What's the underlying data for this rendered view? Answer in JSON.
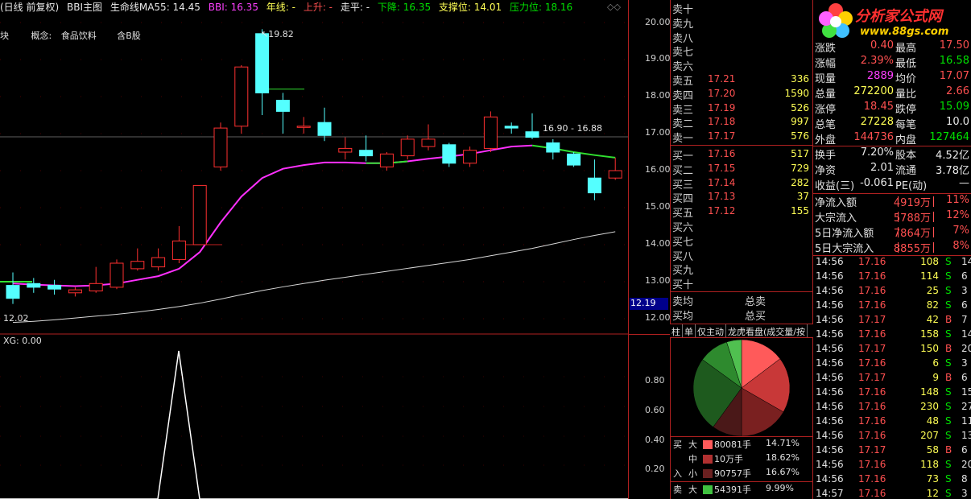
{
  "top_bar": {
    "mode": "(日线 前复权)",
    "indicator": "BBI主图",
    "lifeline": "生命线MA55: 14.45",
    "bbi": "BBI: 16.35",
    "yearline": "年线: -",
    "rise": "上升: -",
    "flat": "走平: -",
    "fall": "下降: 16.35",
    "support": "支撑位: 14.01",
    "pressure": "压力位: 18.16"
  },
  "concept_bar": {
    "prefix": "块",
    "concept_label": "概念:",
    "concept1": "食品饮料",
    "concept2": "含B股"
  },
  "chart_annotations": {
    "high_label": "19.82",
    "range_label": "16.90 - 16.88",
    "low_label": "12.02"
  },
  "price_axis": {
    "ticks": [
      "20.00",
      "19.00",
      "18.00",
      "17.00",
      "16.00",
      "15.00",
      "14.00",
      "13.00",
      "12.00"
    ],
    "current": "12.19",
    "sub_ticks": [
      "0.80",
      "0.60",
      "0.40",
      "0.20"
    ]
  },
  "sub_chart": {
    "label": "XG: 0.00"
  },
  "orderbook": {
    "sell": [
      {
        "label": "卖十",
        "price": "",
        "vol": ""
      },
      {
        "label": "卖九",
        "price": "",
        "vol": ""
      },
      {
        "label": "卖八",
        "price": "",
        "vol": ""
      },
      {
        "label": "卖七",
        "price": "",
        "vol": ""
      },
      {
        "label": "卖六",
        "price": "",
        "vol": ""
      },
      {
        "label": "卖五",
        "price": "17.21",
        "vol": "336"
      },
      {
        "label": "卖四",
        "price": "17.20",
        "vol": "1590"
      },
      {
        "label": "卖三",
        "price": "17.19",
        "vol": "526"
      },
      {
        "label": "卖二",
        "price": "17.18",
        "vol": "997"
      },
      {
        "label": "卖一",
        "price": "17.17",
        "vol": "576"
      }
    ],
    "buy": [
      {
        "label": "买一",
        "price": "17.16",
        "vol": "517"
      },
      {
        "label": "买二",
        "price": "17.15",
        "vol": "729"
      },
      {
        "label": "买三",
        "price": "17.14",
        "vol": "282"
      },
      {
        "label": "买四",
        "price": "17.13",
        "vol": "37"
      },
      {
        "label": "买五",
        "price": "17.12",
        "vol": "155"
      },
      {
        "label": "买六",
        "price": "",
        "vol": ""
      },
      {
        "label": "买七",
        "price": "",
        "vol": ""
      },
      {
        "label": "买八",
        "price": "",
        "vol": ""
      },
      {
        "label": "买九",
        "price": "",
        "vol": ""
      },
      {
        "label": "买十",
        "price": "",
        "vol": ""
      }
    ],
    "avg_sell": "卖均",
    "total_sell": "总卖",
    "avg_buy": "买均",
    "total_buy": "总买"
  },
  "tabs": [
    "柱",
    "单",
    "仅主动",
    "龙虎看盘(成交量/按"
  ],
  "flow": {
    "buy_label": "买",
    "in_label": "入",
    "sell_label": "卖",
    "rows": [
      {
        "size": "大",
        "amount": "80081手",
        "pct": "14.71%",
        "color": "#ff5a5a"
      },
      {
        "size": "中",
        "amount": "10万手",
        "pct": "18.62%",
        "color": "#b03030"
      },
      {
        "size": "小",
        "amount": "90757手",
        "pct": "16.67%",
        "color": "#6a2020"
      },
      {
        "size": "大",
        "amount": "54391手",
        "pct": "9.99%",
        "color": "#40c040"
      }
    ]
  },
  "pie_colors": [
    "#ff5a5a",
    "#c83838",
    "#7a2020",
    "#4a1818",
    "#1e5a1e",
    "#2e8a2e",
    "#50c050"
  ],
  "logo": {
    "title": "分析家公式网",
    "url": "www.88gs.com"
  },
  "quote": [
    {
      "k1": "涨跌",
      "v1": "0.40",
      "c1": "red",
      "k2": "最高",
      "v2": "17.50",
      "c2": "red"
    },
    {
      "k1": "涨幅",
      "v1": "2.39%",
      "c1": "red",
      "k2": "最低",
      "v2": "16.58",
      "c2": "green"
    },
    {
      "k1": "现量",
      "v1": "2889",
      "c1": "magenta",
      "k2": "均价",
      "v2": "17.07",
      "c2": "red"
    },
    {
      "k1": "总量",
      "v1": "272200",
      "c1": "yellow",
      "k2": "量比",
      "v2": "2.66",
      "c2": "red"
    },
    {
      "k1": "涨停",
      "v1": "18.45",
      "c1": "red",
      "k2": "跌停",
      "v2": "15.09",
      "c2": "green"
    },
    {
      "k1": "总笔",
      "v1": "27228",
      "c1": "yellow",
      "k2": "每笔",
      "v2": "10.0",
      "c2": "white"
    },
    {
      "k1": "外盘",
      "v1": "144736",
      "c1": "red",
      "k2": "内盘",
      "v2": "127464",
      "c2": "green"
    }
  ],
  "fundamentals": [
    {
      "k1": "换手",
      "v1": "7.20%",
      "k2": "股本",
      "v2": "4.52亿"
    },
    {
      "k1": "净资",
      "v1": "2.01",
      "k2": "流通",
      "v2": "3.78亿"
    },
    {
      "k1": "收益(三)",
      "v1": "-0.061",
      "k2": "PE(动)",
      "v2": "—"
    }
  ],
  "capital_flow": [
    {
      "k": "净流入额",
      "v": "4919万",
      "p": "11%"
    },
    {
      "k": "大宗流入",
      "v": "5788万",
      "p": "12%"
    },
    {
      "k": "5日净流入额",
      "v": "7864万",
      "p": "7%"
    },
    {
      "k": "5日大宗流入",
      "v": "8855万",
      "p": "8%"
    }
  ],
  "ticks": [
    {
      "t": "14:56",
      "p": "17.16",
      "v": "108",
      "d": "S",
      "n": "14"
    },
    {
      "t": "14:56",
      "p": "17.16",
      "v": "114",
      "d": "S",
      "n": "6"
    },
    {
      "t": "14:56",
      "p": "17.16",
      "v": "25",
      "d": "S",
      "n": "3"
    },
    {
      "t": "14:56",
      "p": "17.16",
      "v": "82",
      "d": "S",
      "n": "6"
    },
    {
      "t": "14:56",
      "p": "17.17",
      "v": "42",
      "d": "B",
      "n": "7"
    },
    {
      "t": "14:56",
      "p": "17.16",
      "v": "158",
      "d": "S",
      "n": "14"
    },
    {
      "t": "14:56",
      "p": "17.17",
      "v": "150",
      "d": "B",
      "n": "20"
    },
    {
      "t": "14:56",
      "p": "17.16",
      "v": "6",
      "d": "S",
      "n": "3"
    },
    {
      "t": "14:56",
      "p": "17.17",
      "v": "9",
      "d": "B",
      "n": "6"
    },
    {
      "t": "14:56",
      "p": "17.16",
      "v": "148",
      "d": "S",
      "n": "15"
    },
    {
      "t": "14:56",
      "p": "17.16",
      "v": "230",
      "d": "S",
      "n": "27"
    },
    {
      "t": "14:56",
      "p": "17.16",
      "v": "48",
      "d": "S",
      "n": "11"
    },
    {
      "t": "14:56",
      "p": "17.16",
      "v": "207",
      "d": "S",
      "n": "13"
    },
    {
      "t": "14:56",
      "p": "17.17",
      "v": "58",
      "d": "B",
      "n": "6"
    },
    {
      "t": "14:56",
      "p": "17.16",
      "v": "118",
      "d": "S",
      "n": "20"
    },
    {
      "t": "14:56",
      "p": "17.16",
      "v": "73",
      "d": "S",
      "n": "8"
    },
    {
      "t": "14:57",
      "p": "17.16",
      "v": "12",
      "d": "S",
      "n": "3"
    }
  ],
  "candles": [
    {
      "o": 12.9,
      "c": 12.55,
      "h": 13.25,
      "l": 12.4
    },
    {
      "o": 12.95,
      "c": 12.85,
      "h": 13.1,
      "l": 12.7
    },
    {
      "o": 12.9,
      "c": 12.8,
      "h": 13.05,
      "l": 12.65
    },
    {
      "o": 12.7,
      "c": 12.78,
      "h": 12.85,
      "l": 12.6
    },
    {
      "o": 12.75,
      "c": 12.95,
      "h": 13.4,
      "l": 12.7
    },
    {
      "o": 12.85,
      "c": 13.5,
      "h": 13.6,
      "l": 12.8
    },
    {
      "o": 13.35,
      "c": 13.55,
      "h": 13.9,
      "l": 13.3
    },
    {
      "o": 13.4,
      "c": 13.65,
      "h": 13.9,
      "l": 13.3
    },
    {
      "o": 13.6,
      "c": 14.1,
      "h": 14.5,
      "l": 13.5
    },
    {
      "o": 14.0,
      "c": 15.6,
      "h": 15.6,
      "l": 14.0
    },
    {
      "o": 16.1,
      "c": 17.15,
      "h": 17.3,
      "l": 16.0
    },
    {
      "o": 17.2,
      "c": 18.8,
      "h": 18.85,
      "l": 17.0
    },
    {
      "o": 19.7,
      "c": 18.1,
      "h": 19.82,
      "l": 17.5
    },
    {
      "o": 17.9,
      "c": 17.6,
      "h": 18.1,
      "l": 17.0
    },
    {
      "o": 17.2,
      "c": 17.2,
      "h": 17.45,
      "l": 17.0
    },
    {
      "o": 17.3,
      "c": 16.95,
      "h": 17.7,
      "l": 16.8
    },
    {
      "o": 16.5,
      "c": 16.6,
      "h": 16.9,
      "l": 16.3
    },
    {
      "o": 16.55,
      "c": 16.4,
      "h": 16.95,
      "l": 16.25
    },
    {
      "o": 16.1,
      "c": 16.45,
      "h": 16.5,
      "l": 16.0
    },
    {
      "o": 16.4,
      "c": 16.85,
      "h": 16.95,
      "l": 16.3
    },
    {
      "o": 16.65,
      "c": 16.85,
      "h": 17.25,
      "l": 16.55
    },
    {
      "o": 16.7,
      "c": 16.2,
      "h": 16.75,
      "l": 16.1
    },
    {
      "o": 16.2,
      "c": 16.55,
      "h": 16.65,
      "l": 16.1
    },
    {
      "o": 16.6,
      "c": 17.45,
      "h": 17.6,
      "l": 16.5
    },
    {
      "o": 17.2,
      "c": 17.15,
      "h": 17.3,
      "l": 17.0
    },
    {
      "o": 17.05,
      "c": 16.9,
      "h": 17.55,
      "l": 16.85
    },
    {
      "o": 16.75,
      "c": 16.5,
      "h": 16.85,
      "l": 16.3
    },
    {
      "o": 16.45,
      "c": 16.15,
      "h": 16.5,
      "l": 16.1
    },
    {
      "o": 15.8,
      "c": 15.4,
      "h": 16.3,
      "l": 15.2
    },
    {
      "o": 15.8,
      "c": 16.0,
      "h": 16.35,
      "l": 15.75
    }
  ],
  "bbi_line": [
    12.95,
    12.92,
    12.9,
    12.88,
    12.9,
    12.95,
    13.05,
    13.15,
    13.35,
    13.8,
    14.6,
    15.3,
    15.8,
    16.05,
    16.15,
    16.22,
    16.22,
    16.2,
    16.2,
    16.25,
    16.32,
    16.38,
    16.45,
    16.55,
    16.65,
    16.68,
    16.6,
    16.5,
    16.42,
    16.35
  ],
  "ma55_line": [
    11.9,
    11.93,
    11.97,
    12.02,
    12.07,
    12.12,
    12.18,
    12.25,
    12.33,
    12.42,
    12.53,
    12.65,
    12.76,
    12.86,
    12.95,
    13.04,
    13.12,
    13.2,
    13.28,
    13.36,
    13.44,
    13.52,
    13.6,
    13.7,
    13.8,
    13.9,
    14.02,
    14.14,
    14.25,
    14.35
  ]
}
